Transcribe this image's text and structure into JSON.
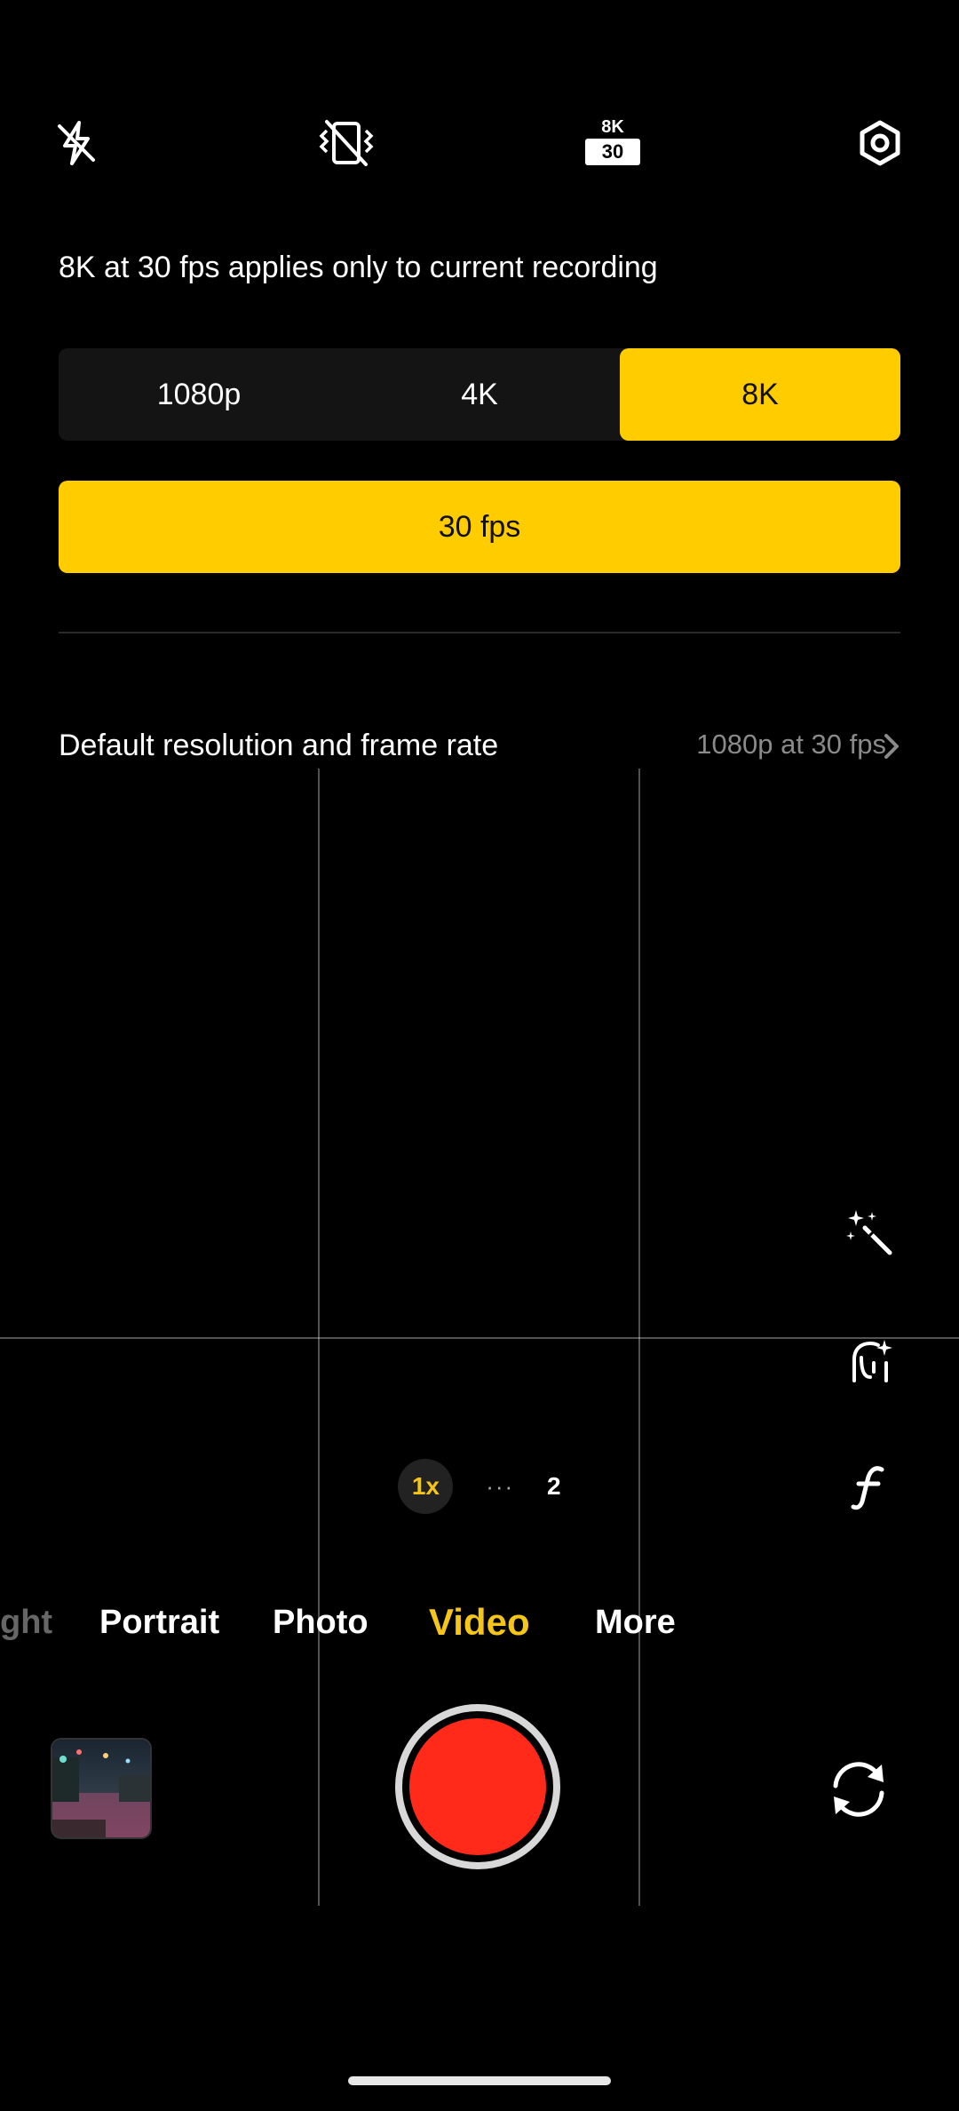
{
  "top_bar": {
    "flash_icon": "flash-off-icon",
    "stabilization_icon": "stabilization-off-icon",
    "resolution_badge": {
      "top": "8K",
      "bottom": "30"
    },
    "settings_icon": "settings-hex-icon"
  },
  "panel": {
    "info_text": "8K at 30 fps applies only to current recording",
    "resolutions": [
      "1080p",
      "4K",
      "8K"
    ],
    "selected_resolution": "8K",
    "fps_label": "30 fps",
    "default_row": {
      "label": "Default resolution and frame rate",
      "value": "1080p at 30 fps"
    }
  },
  "side_tools": [
    "magic-wand-icon",
    "face-retouch-icon",
    "filter-f-icon"
  ],
  "zoom": {
    "active": "1x",
    "dots": "···",
    "next": "2"
  },
  "modes": [
    "ght",
    "Portrait",
    "Photo",
    "Video",
    "More"
  ],
  "active_mode": "Video",
  "colors": {
    "accent": "#ffcc00",
    "record": "#ff2a1a",
    "mode_active": "#f5c518"
  }
}
